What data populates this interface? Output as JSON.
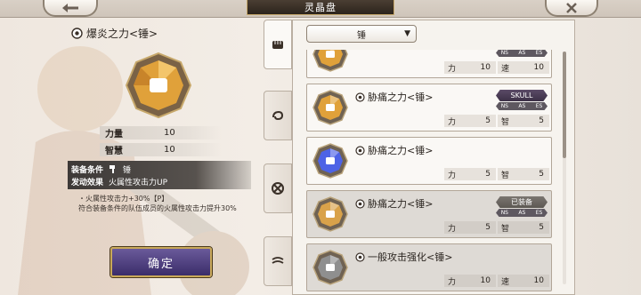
{
  "header": {
    "title": "灵晶盘",
    "back_icon": "arrow-left-icon",
    "close_icon": "close-icon"
  },
  "detail": {
    "name": "爆炎之力<锤>",
    "stats": [
      {
        "name": "力量",
        "value": "10"
      },
      {
        "name": "智慧",
        "value": "10"
      }
    ],
    "equip_condition_label": "装备条件",
    "equip_condition_value": "锤",
    "effect_label": "发动效果",
    "effect_value": "火属性攻击力UP",
    "desc_line1": "・火属性攻击力+30%【P】",
    "desc_line2": "符合装备条件的队伍成员的火属性攻击力提升30%"
  },
  "confirm_label": "确定",
  "filter": {
    "value": "锤"
  },
  "sidetabs": [
    "fist-icon",
    "swirl-icon",
    "cross-icon",
    "wind-icon"
  ],
  "ns_labels": [
    "NS",
    "AS",
    "ES"
  ],
  "gems": [
    {
      "name": "",
      "color": "#e0a13a",
      "dim": false,
      "badge": "",
      "stat1": {
        "k": "力",
        "v": "10"
      },
      "stat2": {
        "k": "速",
        "v": "10"
      }
    },
    {
      "name": "胁痛之力<锤>",
      "color": "#e0a13a",
      "dim": false,
      "badge": "SKULL",
      "stat1": {
        "k": "力",
        "v": "5"
      },
      "stat2": {
        "k": "智",
        "v": "5"
      }
    },
    {
      "name": "胁痛之力<锤>",
      "color": "#4d63e6",
      "dim": false,
      "badge": "",
      "stat1": {
        "k": "力",
        "v": "5"
      },
      "stat2": {
        "k": "智",
        "v": "5"
      }
    },
    {
      "name": "胁痛之力<锤>",
      "color": "#d9a24a",
      "dim": true,
      "badge": "已装备",
      "stat1": {
        "k": "力",
        "v": "5"
      },
      "stat2": {
        "k": "智",
        "v": "5"
      }
    },
    {
      "name": "一般攻击强化<锤>",
      "color": "#8f8f8f",
      "dim": true,
      "badge": "",
      "stat1": {
        "k": "力",
        "v": "10"
      },
      "stat2": {
        "k": "速",
        "v": "10"
      }
    }
  ]
}
